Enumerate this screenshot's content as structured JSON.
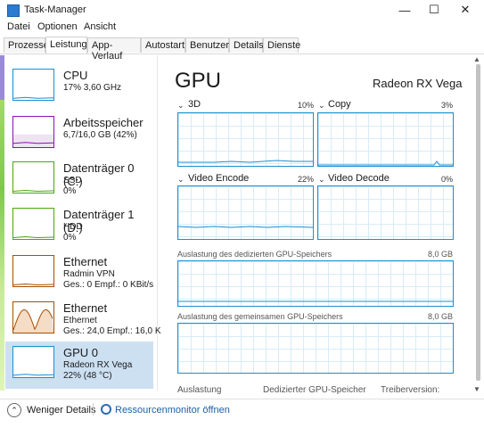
{
  "window": {
    "title": "Task-Manager",
    "controls": {
      "minimize": "—",
      "maximize": "☐",
      "close": "✕"
    }
  },
  "menu": [
    "Datei",
    "Optionen",
    "Ansicht"
  ],
  "tabs": [
    "Prozesse",
    "Leistung",
    "App-Verlauf",
    "Autostart",
    "Benutzer",
    "Details",
    "Dienste"
  ],
  "active_tab": "Leistung",
  "sidebar": [
    {
      "title": "CPU",
      "sub": "17% 3,60 GHz",
      "sub2": "",
      "color": "#1a8fd0",
      "level": 0.17
    },
    {
      "title": "Arbeitsspeicher",
      "sub": "6,7/16,0 GB (42%)",
      "sub2": "",
      "color": "#8b12ae",
      "level": 0.42
    },
    {
      "title": "Datenträger 0 (C:)",
      "sub": "SSD",
      "sub2": "0%",
      "color": "#4da60c",
      "level": 0.0
    },
    {
      "title": "Datenträger 1 (D:)",
      "sub": "HDD",
      "sub2": "0%",
      "color": "#4da60c",
      "level": 0.0
    },
    {
      "title": "Ethernet",
      "sub": "Radmin VPN",
      "sub2": "Ges.: 0 Empf.: 0 KBit/s",
      "color": "#a74f01",
      "level": 0.0
    },
    {
      "title": "Ethernet",
      "sub": "Ethernet",
      "sub2": "Ges.: 24,0 Empf.: 16,0 K",
      "color": "#a74f01",
      "level": 0.6
    },
    {
      "title": "GPU 0",
      "sub": "Radeon RX Vega",
      "sub2": "22% (48 °C)",
      "color": "#1a8fd0",
      "level": 0.22
    }
  ],
  "gpu": {
    "title": "GPU",
    "model": "Radeon RX Vega",
    "engines": [
      {
        "label": "3D",
        "pct": "10%"
      },
      {
        "label": "Copy",
        "pct": "3%"
      },
      {
        "label": "Video Encode",
        "pct": "22%"
      },
      {
        "label": "Video Decode",
        "pct": "0%"
      }
    ],
    "dedicated_label": "Auslastung des dedizierten GPU-Speichers",
    "dedicated_max": "8,0 GB",
    "shared_label": "Auslastung des gemeinsamen GPU-Speichers",
    "shared_max": "8,0 GB",
    "stats_labels": [
      "Auslastung",
      "Dedizierter GPU-Speicher",
      "Treiberversion:"
    ]
  },
  "footer": {
    "fewer_details": "Weniger Details",
    "resource_monitor": "Ressourcenmonitor öffnen"
  }
}
